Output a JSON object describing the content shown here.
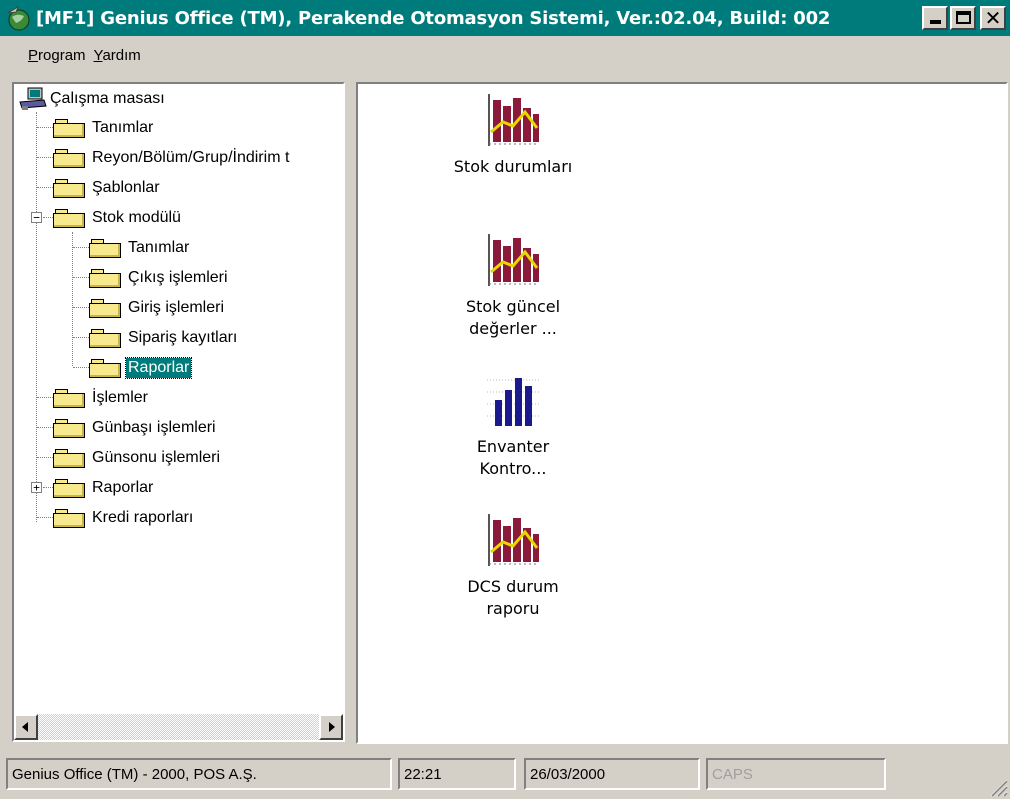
{
  "window": {
    "title": "[MF1] Genius Office (TM), Perakende Otomasyon Sistemi, Ver.:02.04, Build: 002"
  },
  "menu": [
    {
      "label": "Program",
      "mnemonic": "P",
      "rest": "rogram"
    },
    {
      "label": "Yardım",
      "mnemonic": "Y",
      "rest": "ardım"
    }
  ],
  "tree": {
    "root": "Çalışma masası",
    "items": [
      {
        "label": "Tanımlar"
      },
      {
        "label": "Reyon/Bölüm/Grup/İndirim t"
      },
      {
        "label": "Şablonlar"
      },
      {
        "label": "Stok modülü",
        "expanded": true
      },
      {
        "label": "Tanımlar"
      },
      {
        "label": "Çıkış işlemleri"
      },
      {
        "label": "Giriş işlemleri"
      },
      {
        "label": "Sipariş kayıtları"
      },
      {
        "label": "Raporlar",
        "selected": true
      },
      {
        "label": "İşlemler"
      },
      {
        "label": "Günbaşı işlemleri"
      },
      {
        "label": "Günsonu işlemleri"
      },
      {
        "label": "Raporlar",
        "expanded": false
      },
      {
        "label": "Kredi raporları"
      }
    ]
  },
  "reports": [
    {
      "line1": "Stok durumları",
      "line2": "",
      "icon": "bar-line-chart-icon"
    },
    {
      "line1": "Stok güncel",
      "line2": "değerler ...",
      "icon": "bar-line-chart-icon"
    },
    {
      "line1": "Envanter",
      "line2": "Kontro...",
      "icon": "bar-chart-icon"
    },
    {
      "line1": "DCS durum",
      "line2": "raporu",
      "icon": "bar-line-chart-icon"
    }
  ],
  "status": {
    "company": "Genius Office (TM) - 2000, POS A.Ş.",
    "time": "22:21",
    "date": "26/03/2000",
    "caps": "CAPS"
  },
  "colors": {
    "titlebar": "#007b7b",
    "selection": "#007b7b",
    "face": "#d4d0c8",
    "bar_maroon": "#8b1a3a",
    "trend_yellow": "#e8d800",
    "bar_blue": "#1a1a8c"
  }
}
